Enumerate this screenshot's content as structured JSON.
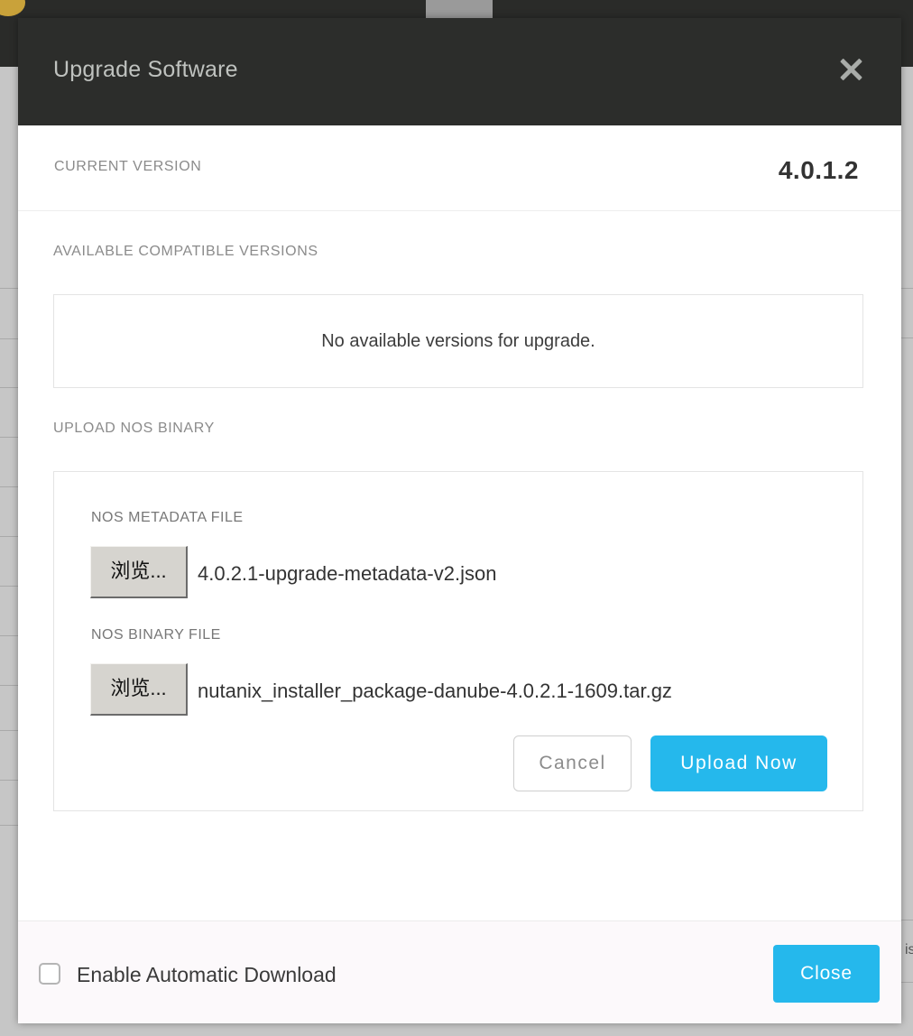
{
  "background": {
    "right_edge_text": "is"
  },
  "dialog": {
    "title": "Upgrade Software",
    "current_version_label": "CURRENT VERSION",
    "current_version_value": "4.0.1.2",
    "available_label": "AVAILABLE COMPATIBLE VERSIONS",
    "no_versions_text": "No available versions for upgrade.",
    "upload_label": "UPLOAD NOS BINARY",
    "metadata_file_label": "NOS METADATA FILE",
    "metadata_browse_label": "浏览...",
    "metadata_file_name": "4.0.2.1-upgrade-metadata-v2.json",
    "binary_file_label": "NOS BINARY FILE",
    "binary_browse_label": "浏览...",
    "binary_file_name": "nutanix_installer_package-danube-4.0.2.1-1609.tar.gz",
    "cancel_label": "Cancel",
    "upload_now_label": "Upload Now",
    "auto_download_label": "Enable Automatic Download",
    "auto_download_checked": false,
    "close_label": "Close"
  },
  "colors": {
    "header_bg": "#2c2d2b",
    "accent": "#25b8ec"
  }
}
